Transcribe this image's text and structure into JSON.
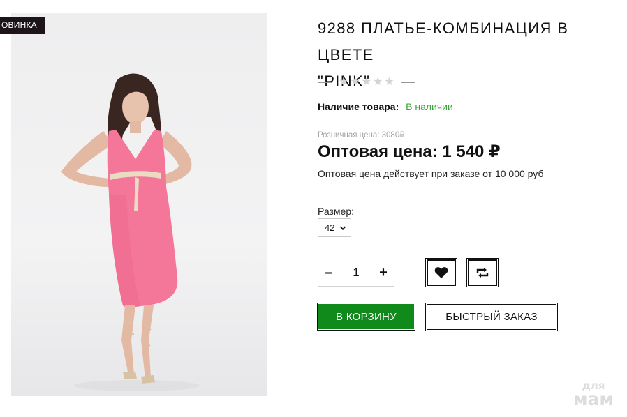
{
  "product": {
    "badge": "ОВИНКА",
    "title": "9288 ПЛАТЬЕ-КОМБИНАЦИЯ В ЦВЕТЕ\n\"PINK\"",
    "rating": {
      "value": 0,
      "max": 5
    },
    "availability": {
      "label": "Наличие товара:",
      "value": "В наличии",
      "color": "#3aa335"
    },
    "retail_price": "Розничная цена: 3080₽",
    "wholesale_price": "Оптовая цена: 1 540 ₽",
    "wholesale_note": "Оптовая цена действует при заказе от 10 000 руб"
  },
  "size": {
    "label": "Размер:",
    "selected": "42"
  },
  "quantity": {
    "value": "1",
    "minus": "–",
    "plus": "+"
  },
  "actions": {
    "favorite_icon": "heart-icon",
    "compare_icon": "compare-arrows-icon",
    "cart_label": "В КОРЗИНУ",
    "quick_order_label": "БЫСТРЫЙ ЗАКАЗ",
    "cart_color": "#0f8a1b"
  },
  "watermark": {
    "line1": "для",
    "line2": "мам"
  }
}
